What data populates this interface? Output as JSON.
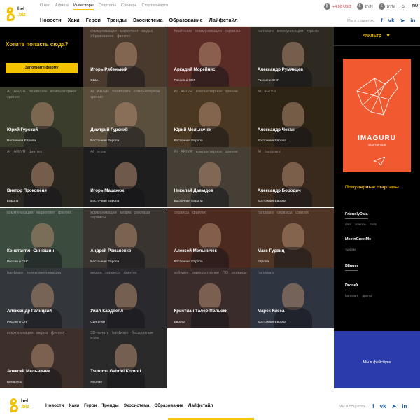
{
  "header": {
    "logo_top": "bel",
    "logo_bottom": ".biz",
    "top_nav": [
      "О нас",
      "Афиша",
      "Инвесторы",
      "Стартапы",
      "Словарь",
      "Стартап-карта"
    ],
    "active_top_index": 2,
    "main_nav": [
      "Новости",
      "Хаки",
      "Герои",
      "Тренды",
      "Экосистема",
      "Образование",
      "Лайфстайл"
    ],
    "rates": [
      {
        "icon": "bitcoin-icon",
        "symbol": "₿",
        "value": "+4,90 USD",
        "negative": true
      },
      {
        "icon": "dollar-icon",
        "symbol": "$",
        "value": "BYN",
        "negative": false
      },
      {
        "icon": "euro-icon",
        "symbol": "€",
        "value": "BYN",
        "negative": false
      }
    ],
    "lang": "RU",
    "social_label": "Мы в соцсетях",
    "social": [
      {
        "icon": "facebook-icon",
        "glyph": "f"
      },
      {
        "icon": "vk-icon",
        "glyph": "vk"
      },
      {
        "icon": "telegram-icon",
        "glyph": "➤"
      },
      {
        "icon": "linkedin-icon",
        "glyph": "in"
      }
    ]
  },
  "cta": {
    "question": "Хотите попасть сюда?",
    "button": "Заполните форму"
  },
  "investors": [
    {
      "name": "",
      "region": "",
      "tags": ""
    },
    {
      "name": "Игорь Рябенький",
      "region": "США",
      "tags": "коммуникации маркетинг медиа образование финтех"
    },
    {
      "name": "Аркадий Морейнис",
      "region": "Россия и СНГ",
      "tags": "healthcare коммуникации сервисы"
    },
    {
      "name": "Александр Румянцев",
      "region": "Россия и СНГ",
      "tags": "hardware коммуникации туризм"
    },
    {
      "name": "Юрий Гурский",
      "region": "Восточная Европа",
      "tags": "AI AR/VR healthcare компьютерное зрение"
    },
    {
      "name": "Дмитрий Гурский",
      "region": "Восточная Европа",
      "tags": "AI AR/VR healthcare компьютерное зрение"
    },
    {
      "name": "Юрий Мельничек",
      "region": "Восточная Европа",
      "tags": "AI AR/VR компьютерное зрение"
    },
    {
      "name": "Александр Чекан",
      "region": "Восточная Европа",
      "tags": "AI AR/VR"
    },
    {
      "name": "Виктор Прокопеня",
      "region": "Европа",
      "tags": "AI AR/VR финтех"
    },
    {
      "name": "Игорь Мацанюк",
      "region": "Восточная Европа",
      "tags": "AI игры"
    },
    {
      "name": "Николай Давыдов",
      "region": "Восточная Европа",
      "tags": "AI AR/VR компьютерное зрение"
    },
    {
      "name": "Александр Бородич",
      "region": "Восточная Европа",
      "tags": "AI hardware"
    },
    {
      "name": "Константин Синюшин",
      "region": "Россия и СНГ",
      "tags": "коммуникации маркетинг финтех"
    },
    {
      "name": "Андрей Романенко",
      "region": "Восточная Европа",
      "tags": "коммуникации медиа реклама сервисы"
    },
    {
      "name": "Алексей Мельничек",
      "region": "Восточная Европа",
      "tags": "сервисы финтех"
    },
    {
      "name": "Макс Гурвиц",
      "region": "Европа",
      "tags": "hardware сервисы финтех"
    },
    {
      "name": "Александр Галицкий",
      "region": "Россия и СНГ",
      "tags": "hardware телекоммуникации"
    },
    {
      "name": "Уилл Кардвелл",
      "region": "Сингапур",
      "tags": "медиа сервисы финтех"
    },
    {
      "name": "Кристиан Талер-Польски",
      "region": "Европа",
      "tags": "software корпоративное ПО сервисы"
    },
    {
      "name": "Марек Кисса",
      "region": "Восточная Европа",
      "tags": "hardware"
    },
    {
      "name": "Алексей Мельничек",
      "region": "Беларусь",
      "tags": "коммуникации медиа финтех"
    },
    {
      "name": "Tsutomu Gabriel Komori",
      "region": "Япония",
      "tags": "3D-печать hardware бесплатные игры"
    }
  ],
  "cell_colors": [
    "#000000",
    "#4a3a2e",
    "#5b2b26",
    "#2e2a22",
    "#3b3d2c",
    "#5a4e3c",
    "#4a3822",
    "#2d2416",
    "#2a2620",
    "#1e1e1e",
    "#453f35",
    "#3a2a1e",
    "#3b4c3f",
    "#3a3430",
    "#4c2a20",
    "#4f3525",
    "#33363a",
    "#2a2a2e",
    "#3a2c2a",
    "#2e3440",
    "#3d2f2a",
    "#2a2a2a"
  ],
  "sidebar": {
    "filter": "Фильтр",
    "banner_title": "IMAGURU",
    "banner_sub": "STARTUP HUB",
    "banner_color": "#f15a31",
    "popular_title": "Популярные стартапы",
    "startups": [
      {
        "name": "FriendlyData",
        "tags": "data science tools"
      },
      {
        "name": "MeetnGreetMe",
        "tags": "туризм"
      },
      {
        "name": "Blinger",
        "tags": ""
      },
      {
        "name": "DroneX",
        "tags": "hardware дроны"
      }
    ],
    "facebook": "Мы в фейсбуке"
  },
  "footer": {
    "logo_top": "bel",
    "logo_bottom": ".biz",
    "nav": [
      "Новости",
      "Хаки",
      "Герои",
      "Тренды",
      "Экосистема",
      "Образование",
      "Лайфстайл"
    ],
    "social_label": "Мы в соцсетях"
  },
  "colors": {
    "accent": "#f3c300",
    "facebook": "#2b3ba9"
  }
}
